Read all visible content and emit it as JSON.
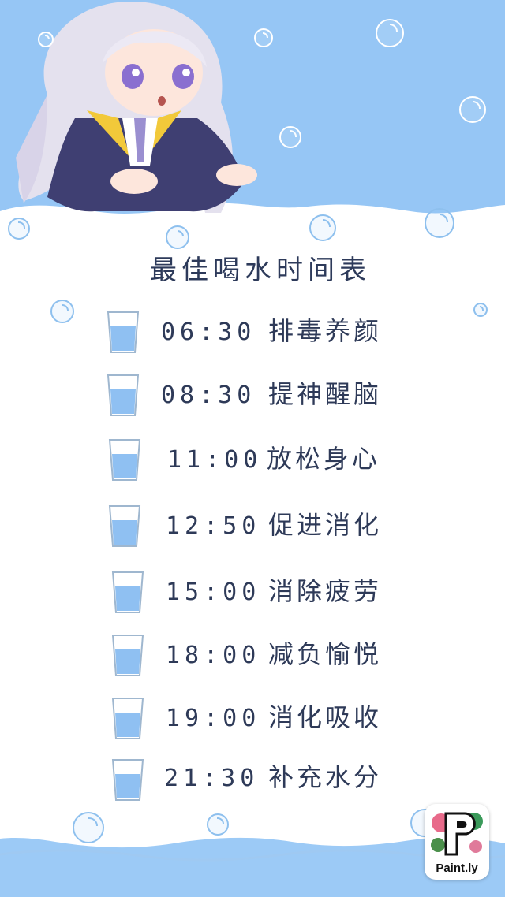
{
  "title": "最佳喝水时间表",
  "schedule": [
    {
      "time": "06:30",
      "label": "排毒养颜"
    },
    {
      "time": "08:30",
      "label": "提神醒脑"
    },
    {
      "time": "11:00",
      "label": "放松身心"
    },
    {
      "time": "12:50",
      "label": "促进消化"
    },
    {
      "time": "15:00",
      "label": "消除疲劳"
    },
    {
      "time": "18:00",
      "label": "减负愉悦"
    },
    {
      "time": "19:00",
      "label": "消化吸收"
    },
    {
      "time": "21:30",
      "label": "补充水分"
    }
  ],
  "badge": {
    "brand": "Paint.ly"
  },
  "colors": {
    "sky": "#96c6f5",
    "paper": "#ffffff",
    "water": "#8fc0f2",
    "text": "#2e3a58"
  }
}
